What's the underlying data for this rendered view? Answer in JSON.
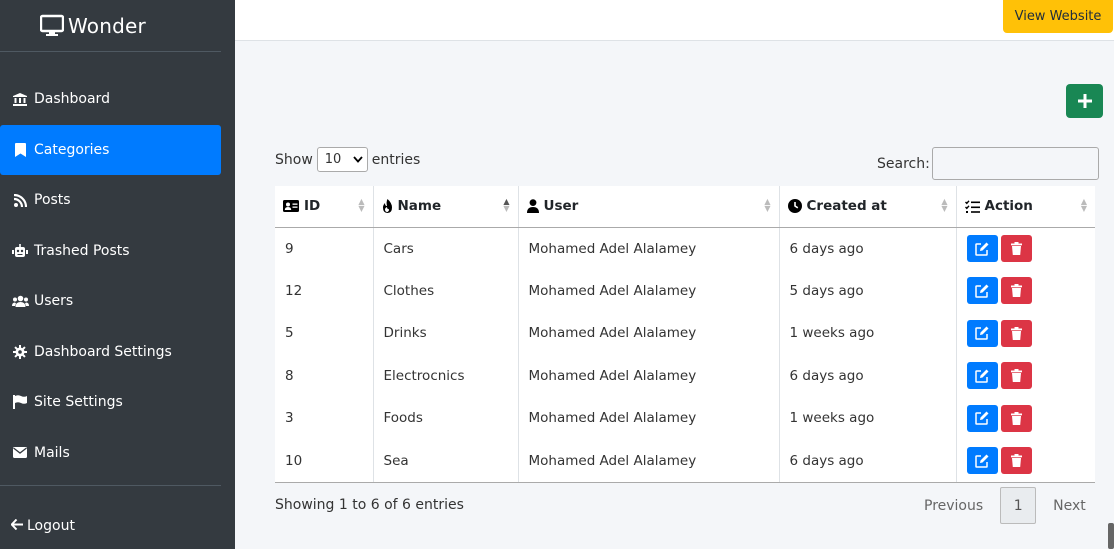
{
  "brand": {
    "name": "Wonder",
    "icon": "monitor-icon"
  },
  "sidebar": {
    "items": [
      {
        "label": "Dashboard",
        "icon": "bank-icon",
        "active": false
      },
      {
        "label": "Categories",
        "icon": "bookmark-icon",
        "active": true
      },
      {
        "label": "Posts",
        "icon": "rss-icon",
        "active": false
      },
      {
        "label": "Trashed Posts",
        "icon": "robot-icon",
        "active": false
      },
      {
        "label": "Users",
        "icon": "users-icon",
        "active": false
      },
      {
        "label": "Dashboard Settings",
        "icon": "gear-icon",
        "active": false
      },
      {
        "label": "Site Settings",
        "icon": "flag-icon",
        "active": false
      },
      {
        "label": "Mails",
        "icon": "envelope-icon",
        "active": false
      }
    ],
    "logout_label": "Logout"
  },
  "topbar": {
    "view_website_label": "View Website"
  },
  "add_button": {
    "icon": "plus-icon",
    "color": "#198754"
  },
  "table_controls": {
    "show_label": "Show",
    "entries_label": "entries",
    "page_length": "10",
    "search_label": "Search:",
    "search_value": ""
  },
  "table": {
    "columns": [
      {
        "label": "ID",
        "icon": "id-card-icon"
      },
      {
        "label": "Name",
        "icon": "fire-icon"
      },
      {
        "label": "User",
        "icon": "user-icon"
      },
      {
        "label": "Created at",
        "icon": "clock-icon"
      },
      {
        "label": "Action",
        "icon": "list-check-icon"
      }
    ],
    "rows": [
      {
        "id": "9",
        "name": "Cars",
        "user": "Mohamed Adel Alalamey",
        "created": "6 days ago"
      },
      {
        "id": "12",
        "name": "Clothes",
        "user": "Mohamed Adel Alalamey",
        "created": "5 days ago"
      },
      {
        "id": "5",
        "name": "Drinks",
        "user": "Mohamed Adel Alalamey",
        "created": "1 weeks ago"
      },
      {
        "id": "8",
        "name": "Electrocnics",
        "user": "Mohamed Adel Alalamey",
        "created": "6 days ago"
      },
      {
        "id": "3",
        "name": "Foods",
        "user": "Mohamed Adel Alalamey",
        "created": "1 weeks ago"
      },
      {
        "id": "10",
        "name": "Sea",
        "user": "Mohamed Adel Alalamey",
        "created": "6 days ago"
      }
    ]
  },
  "footer": {
    "info": "Showing 1 to 6 of 6 entries",
    "previous_label": "Previous",
    "current_page": "1",
    "next_label": "Next"
  },
  "colors": {
    "sidebar_bg": "#343a40",
    "active_item": "#007bff",
    "view_website": "#ffc107",
    "edit_button": "#007bff",
    "delete_button": "#dc3545"
  }
}
